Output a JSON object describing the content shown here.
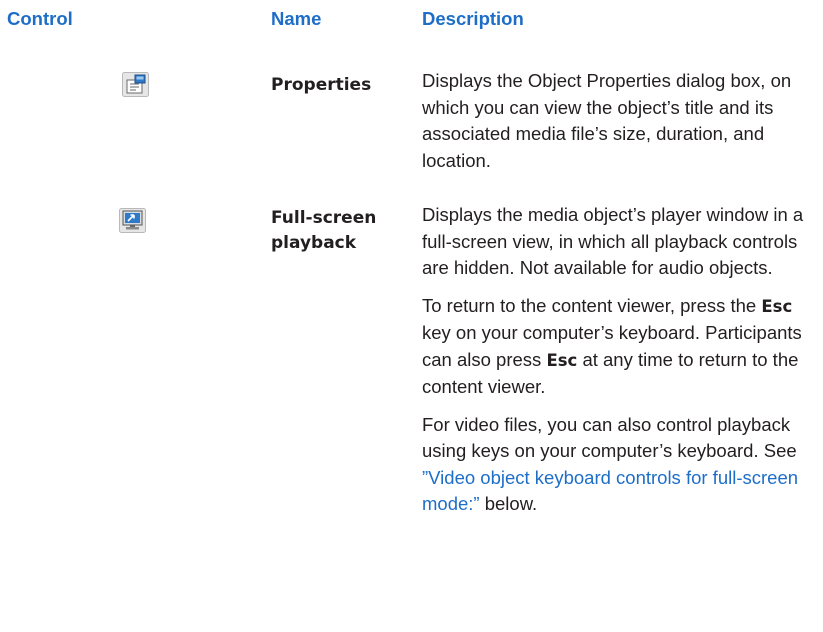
{
  "table": {
    "headers": {
      "control": "Control",
      "name": "Name",
      "description": "Description"
    },
    "rows": [
      {
        "icon": "properties-icon",
        "name": "Properties",
        "description": "Displays the Object Properties dialog box, on which you can view the object’s title and its associated media file’s size, duration, and location."
      },
      {
        "icon": "full-screen-playback-icon",
        "name_line1": "Full-screen",
        "name_line2": "playback",
        "description_p1": "Displays the media object’s player window in a full-screen view, in which all playback controls are hidden. Not available for audio objects.",
        "description_p2": {
          "t1": "To return to the content viewer, press the ",
          "k1": "Esc",
          "t2": " key on your computer’s keyboard. Participants can also press ",
          "k2": "Esc",
          "t3": " at any time to return to the content viewer."
        },
        "description_p3": {
          "t1": "For video files, you can also control playback using keys on your computer’s keyboard. See ",
          "link": "”Video object keyboard controls for full-screen mode:”",
          "t2": " below."
        }
      }
    ]
  },
  "colors": {
    "header": "#1e6ec8",
    "link": "#1e6ec8",
    "text": "#231f20"
  }
}
